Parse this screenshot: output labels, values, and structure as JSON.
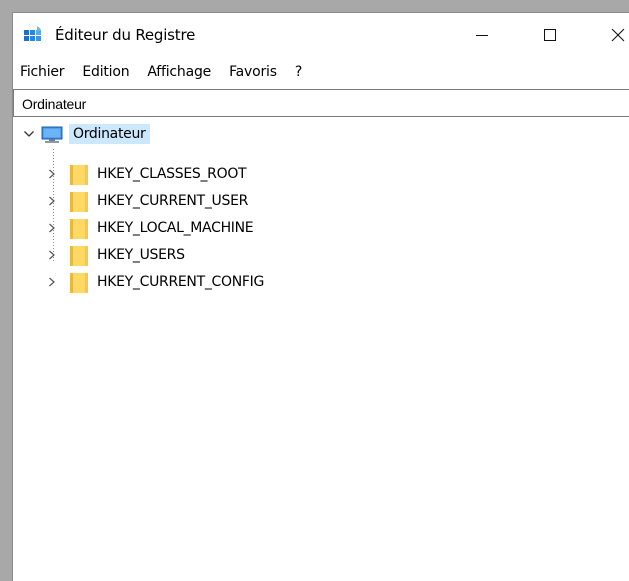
{
  "window": {
    "title": "Éditeur du Registre"
  },
  "menu": {
    "items": [
      {
        "label": "Fichier"
      },
      {
        "label": "Edition"
      },
      {
        "label": "Affichage"
      },
      {
        "label": "Favoris"
      },
      {
        "label": "?"
      }
    ]
  },
  "address": {
    "value": "Ordinateur"
  },
  "tree": {
    "root": {
      "label": "Ordinateur",
      "icon": "computer-icon",
      "expanded": true,
      "selected": true
    },
    "children": [
      {
        "label": "HKEY_CLASSES_ROOT",
        "icon": "folder-icon"
      },
      {
        "label": "HKEY_CURRENT_USER",
        "icon": "folder-icon"
      },
      {
        "label": "HKEY_LOCAL_MACHINE",
        "icon": "folder-icon"
      },
      {
        "label": "HKEY_USERS",
        "icon": "folder-icon"
      },
      {
        "label": "HKEY_CURRENT_CONFIG",
        "icon": "folder-icon"
      }
    ]
  },
  "colors": {
    "selection": "#cce8ff",
    "folder": "#ffd966",
    "background": "#ffffff"
  }
}
